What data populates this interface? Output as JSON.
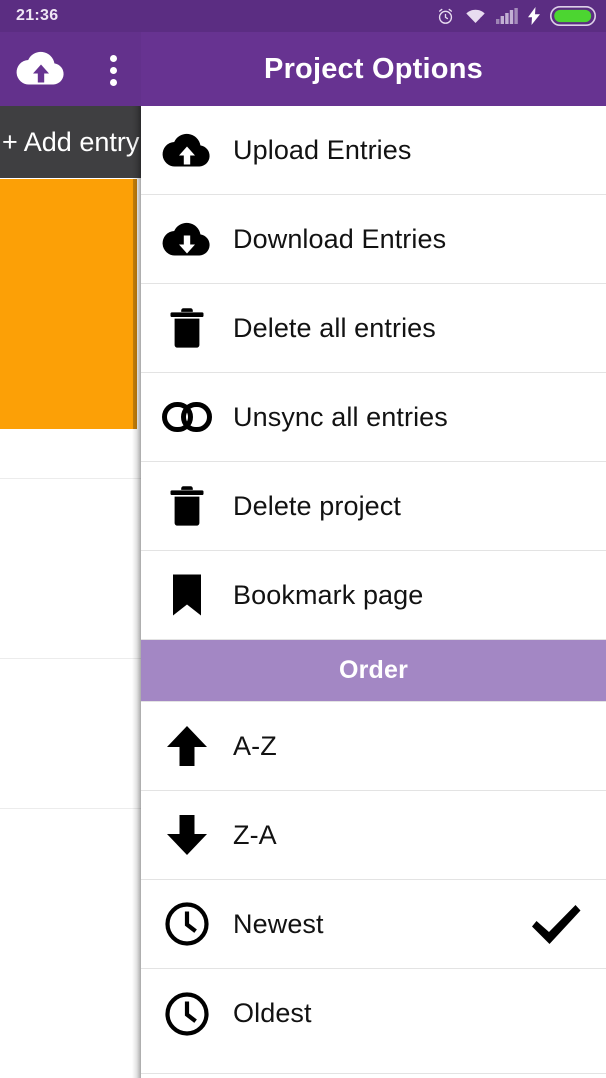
{
  "status_bar": {
    "time": "21:36",
    "icons": [
      "alarm-clock-icon",
      "wifi-icon",
      "signal-bars-icon",
      "charging-bolt-icon",
      "battery-icon"
    ],
    "background_color": "#5b2d82"
  },
  "app_bar": {
    "title": "Project Options",
    "background_color": "#673391",
    "left_icons": [
      "cloud-upload-icon",
      "overflow-menu-icon"
    ]
  },
  "background_screen": {
    "add_entry_label": "+ Add entry",
    "add_entry_background": "#3f3f41",
    "card_color": "#fca006"
  },
  "drawer": {
    "items": [
      {
        "label": "Upload Entries",
        "icon": "cloud-upload-icon",
        "checked": false
      },
      {
        "label": "Download Entries",
        "icon": "cloud-download-icon",
        "checked": false
      },
      {
        "label": "Delete all entries",
        "icon": "trash-icon",
        "checked": false
      },
      {
        "label": "Unsync all entries",
        "icon": "link-icon",
        "checked": false
      },
      {
        "label": "Delete project",
        "icon": "trash-icon",
        "checked": false
      },
      {
        "label": "Bookmark page",
        "icon": "bookmark-icon",
        "checked": false
      }
    ],
    "section": {
      "title": "Order",
      "background_color": "#a387c4"
    },
    "order_items": [
      {
        "label": "A-Z",
        "icon": "arrow-up-icon",
        "checked": false
      },
      {
        "label": "Z-A",
        "icon": "arrow-down-icon",
        "checked": false
      },
      {
        "label": "Newest",
        "icon": "clock-icon",
        "checked": true
      },
      {
        "label": "Oldest",
        "icon": "clock-icon",
        "checked": false
      }
    ]
  }
}
